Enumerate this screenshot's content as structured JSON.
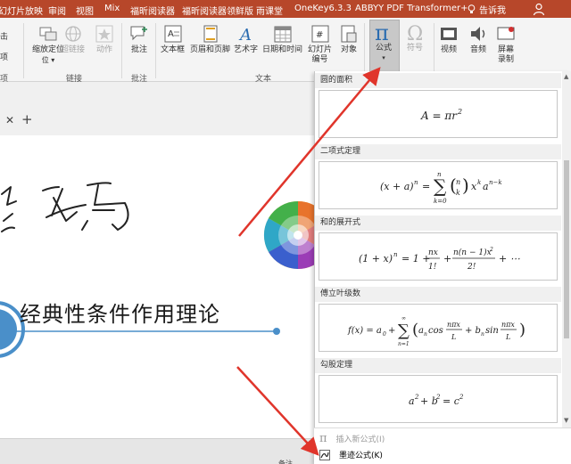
{
  "menubar": {
    "items": [
      "幻灯片放映",
      "审阅",
      "视图",
      "Mix",
      "福昕阅读器",
      "福昕阅读器领鲜版",
      "雨课堂",
      "OneKey6.3.3",
      "ABBYY PDF Transformer+"
    ],
    "tell_me": "告诉我",
    "tell_me_icon": "lightbulb-icon",
    "share_icon": "person-icon",
    "color": "#b7472a"
  },
  "ribbon": {
    "left_partial": [
      "击",
      "项"
    ],
    "buttons": {
      "zoom": "缩放定位",
      "hyperlink": "超链接",
      "action": "动作",
      "comment": "批注",
      "textbox": "文本框",
      "header_footer": "页眉和页脚",
      "wordart": "艺术字",
      "datetime": "日期和时间",
      "slide_number_line1": "幻灯片",
      "slide_number_line2": "编号",
      "object": "对象",
      "equation": "公式",
      "symbol": "符号",
      "video": "视频",
      "audio": "音频",
      "screen_line1": "屏幕",
      "screen_line2": "录制"
    },
    "groups": {
      "first": "项",
      "links": "链接",
      "comments": "批注",
      "text": "文本"
    }
  },
  "slide": {
    "title": "经典性条件作用理论",
    "handwriting": "练习"
  },
  "gallery": {
    "sections": [
      {
        "name": "圆的面积",
        "formula": "A = πr²"
      },
      {
        "name": "二项式定理",
        "formula": "(x + a)ⁿ = Σ(n k) xᵏaⁿ⁻ᵏ"
      },
      {
        "name": "和的展开式",
        "formula": "(1 + x)ⁿ = 1 + nx/1! + n(n−1)x²/2! + ⋯"
      },
      {
        "name": "傅立叶级数",
        "formula": "f(x) = a₀ + Σ(aₙ cos nπx/L + bₙ sin nπx/L)"
      },
      {
        "name": "勾股定理",
        "formula": "a² + b² = c²"
      }
    ],
    "footer": {
      "insert_new": "插入新公式(I)",
      "ink_equation": "墨迹公式(K)"
    }
  },
  "bottom": {
    "notes": "备注"
  },
  "colors": {
    "arrow": "#e0352b",
    "ribbon_bg": "#f4f4f4",
    "accent": "#4a8fc9"
  }
}
